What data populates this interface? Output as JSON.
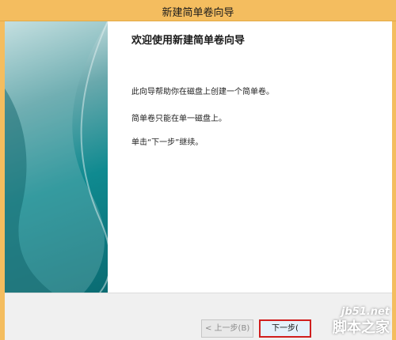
{
  "window": {
    "title": "新建简单卷向导"
  },
  "wizard": {
    "heading": "欢迎使用新建简单卷向导",
    "paragraphs": [
      "此向导帮助你在磁盘上创建一个简单卷。",
      "简单卷只能在单一磁盘上。",
      "单击“下一步”继续。"
    ]
  },
  "buttons": {
    "back_label": "< 上一步(B)",
    "next_label": "下一步("
  },
  "watermark": {
    "url": "jb51.net",
    "name": "脚本之家"
  },
  "colors": {
    "titlebar": "#f4bd5f",
    "banner_teal": "#0f8a90",
    "highlight_border": "#d01e1e"
  }
}
